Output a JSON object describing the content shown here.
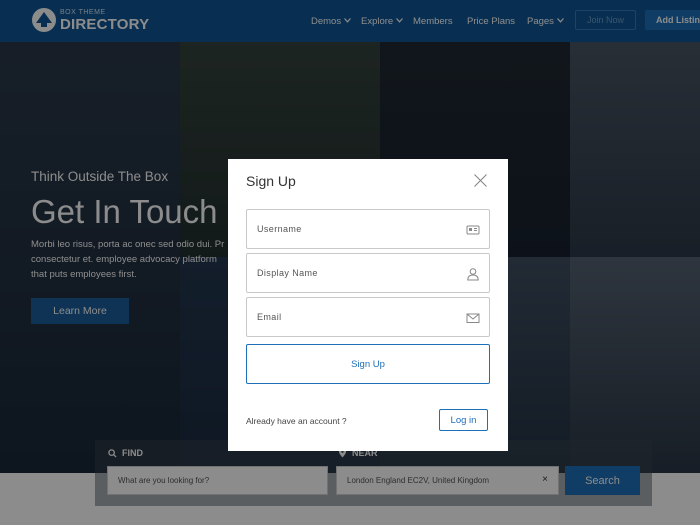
{
  "header": {
    "logo_small": "BOX THEME",
    "logo_big": "DIRECTORY",
    "nav": [
      {
        "label": "Demos",
        "dropdown": true
      },
      {
        "label": "Explore",
        "dropdown": true
      },
      {
        "label": "Members",
        "dropdown": false
      },
      {
        "label": "Price Plans",
        "dropdown": false
      },
      {
        "label": "Pages",
        "dropdown": true
      }
    ],
    "join_label": "Join Now",
    "add_label": "Add Listing"
  },
  "hero": {
    "subtitle": "Think Outside The Box",
    "title": "Get In Touch",
    "description": "Morbi leo risus, porta ac onec sed odio dui. Pr consectetur et. employee advocacy platform that puts employees first.",
    "button_label": "Learn More"
  },
  "search": {
    "find_label": "FIND",
    "near_label": "NEAR",
    "find_placeholder": "What are you looking for?",
    "near_value": "London England EC2V, United Kingdom",
    "clear_glyph": "×",
    "button_label": "Search"
  },
  "modal": {
    "title": "Sign Up",
    "username_placeholder": "Username",
    "display_name_placeholder": "Display Name",
    "email_placeholder": "Email",
    "signup_label": "Sign Up",
    "have_account_text": "Already have an account ?",
    "login_label": "Log in"
  },
  "colors": {
    "header_bg": "#0f5796",
    "accent": "#1d6fb8",
    "overlay": "rgba(0,0,0,0.45)"
  },
  "icons": [
    "logo-mark-icon",
    "chevron-down-icon",
    "close-icon",
    "id-card-icon",
    "user-icon",
    "envelope-icon",
    "search-icon",
    "location-pin-icon"
  ]
}
